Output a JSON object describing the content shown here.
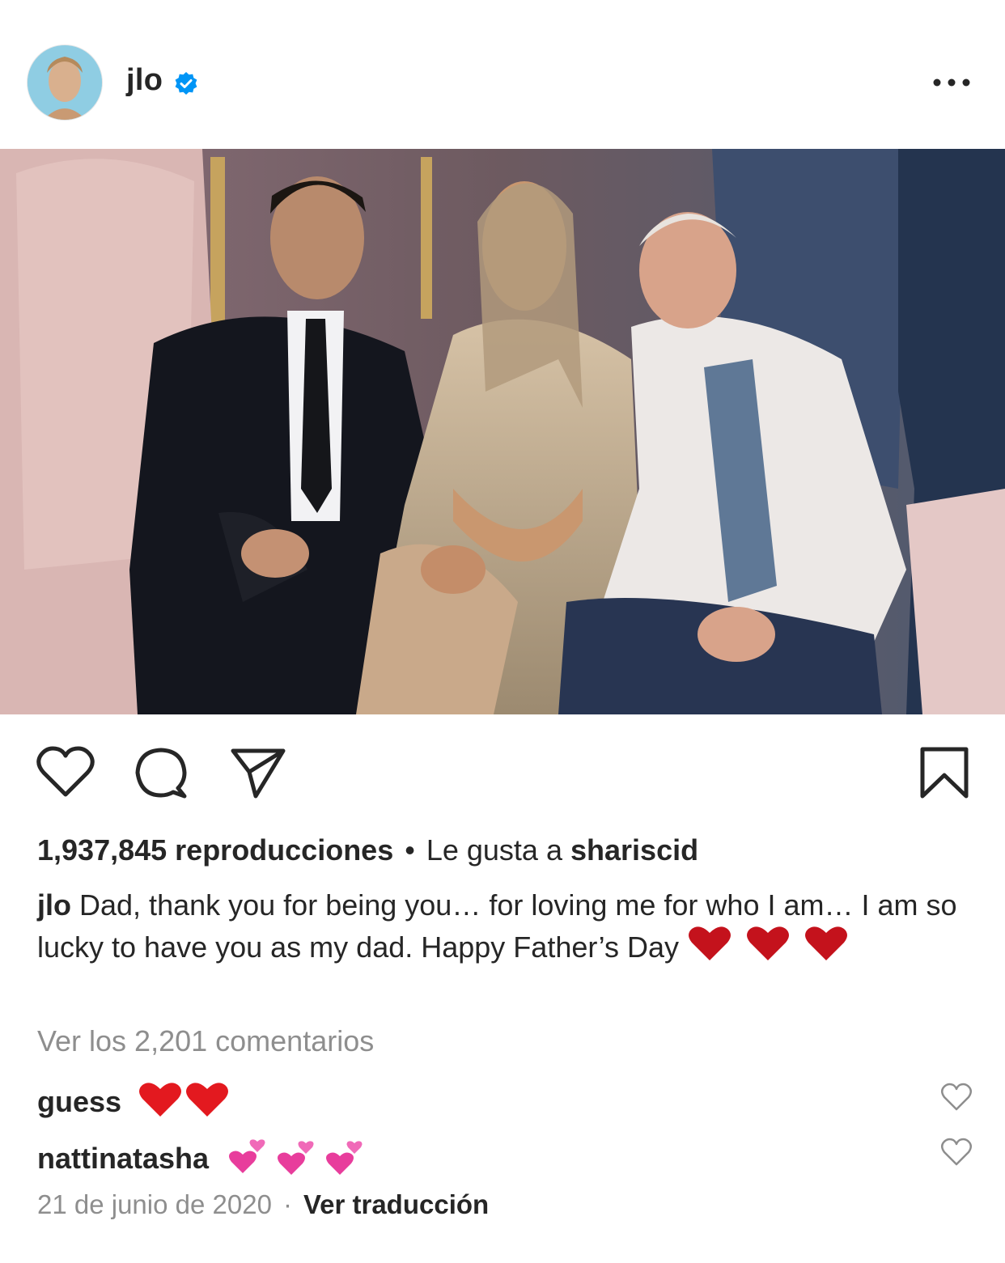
{
  "post": {
    "username": "jlo",
    "verified": true,
    "more_icon": "more-horizontal-icon",
    "media_alt": "Video thumbnail: three people seated at an event",
    "views_text": "1,937,845 reproducciones",
    "liked_by_prefix": "Le gusta a",
    "liked_by_user": "shariscid",
    "caption_user": "jlo",
    "caption_text": "Dad, thank you for being you… for loving me for who I am… I am so lucky to have you as my dad. Happy Father’s Day",
    "caption_emoji": "❤️❤️❤️",
    "view_comments": "Ver los 2,201 comentarios",
    "comments": [
      {
        "user": "guess",
        "text": "❤️❤️",
        "emoji_type": "red-heart"
      },
      {
        "user": "nattinatasha",
        "text": "💕💕💕",
        "emoji_type": "two-hearts"
      }
    ],
    "date": "21 de junio de 2020",
    "translate": "Ver traducción"
  },
  "icons": {
    "like": "heart-icon",
    "comment": "comment-icon",
    "share": "paper-plane-icon",
    "save": "bookmark-icon"
  },
  "colors": {
    "text": "#262626",
    "muted": "#8e8e8e",
    "verified": "#0095f6"
  }
}
